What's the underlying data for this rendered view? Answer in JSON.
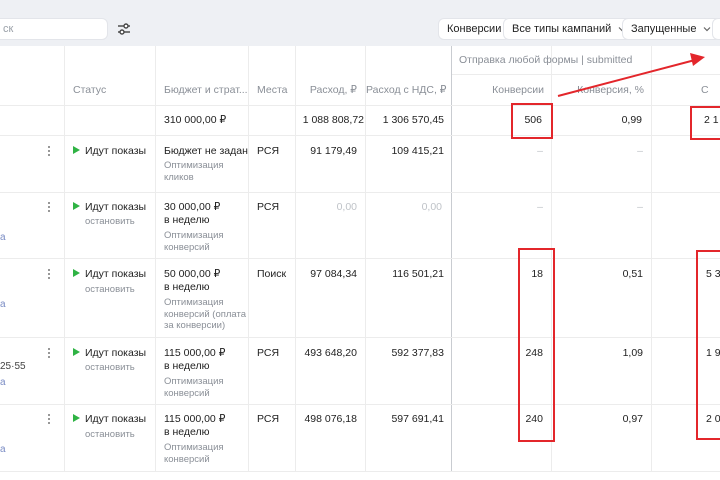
{
  "toolbar": {
    "search_placeholder": "ск",
    "filters": {
      "conversions": "Конверсии",
      "campaign_types": "Все типы кампаний",
      "launched": "Запущенные"
    }
  },
  "group_header": "Отправка любой формы | submitted",
  "columns": {
    "status": "Статус",
    "budget": "Бюджет и страт...",
    "places": "Места",
    "spend": "Расход, ₽",
    "spend_vat": "Расход с НДС, ₽",
    "conversions": "Конверсии",
    "conv_rate": "Конверсия, %",
    "last": "С"
  },
  "totals": {
    "budget": "310 000,00 ₽",
    "spend": "1 088 808,72",
    "spend_vat": "1 306 570,45",
    "conversions": "506",
    "conv_rate": "0,99",
    "last": "2 1"
  },
  "rows": [
    {
      "status": "Идут показы",
      "stop": "",
      "budget_line1": "Бюджет не задан",
      "budget_line2": "",
      "strategy": "Оптимизация\nкликов",
      "places": "РСЯ",
      "spend": "91 179,49",
      "spend_vat": "109 415,21",
      "conversions": "–",
      "conv_rate": "–",
      "last": "",
      "edge": ""
    },
    {
      "status": "Идут показы",
      "stop": "остановить",
      "budget_line1": "30 000,00 ₽",
      "budget_line2": "в неделю",
      "strategy": "Оптимизация\nконверсий",
      "places": "РСЯ",
      "spend": "0,00",
      "spend_vat": "0,00",
      "conversions": "–",
      "conv_rate": "–",
      "last": "",
      "edge": "а"
    },
    {
      "status": "Идут показы",
      "stop": "остановить",
      "budget_line1": "50 000,00 ₽",
      "budget_line2": "в неделю",
      "strategy": "Оптимизация\nконверсий (оплата\nза конверсии)",
      "places": "Поиск",
      "spend": "97 084,34",
      "spend_vat": "116 501,21",
      "conversions": "18",
      "conv_rate": "0,51",
      "last": "5 3",
      "edge": "а"
    },
    {
      "status": "Идут показы",
      "stop": "остановить",
      "budget_line1": "115 000,00 ₽",
      "budget_line2": "в неделю",
      "strategy": "Оптимизация\nконверсий",
      "places": "РСЯ",
      "spend": "493 648,20",
      "spend_vat": "592 377,83",
      "conversions": "248",
      "conv_rate": "1,09",
      "last": "1 9",
      "edge_top": "25·55",
      "edge": "а"
    },
    {
      "status": "Идут показы",
      "stop": "остановить",
      "budget_line1": "115 000,00 ₽",
      "budget_line2": "в неделю",
      "strategy": "Оптимизация\nконверсий",
      "places": "РСЯ",
      "spend": "498 076,18",
      "spend_vat": "597 691,41",
      "conversions": "240",
      "conv_rate": "0,97",
      "last": "2 0",
      "edge": "а"
    }
  ],
  "colors": {
    "annotation_red": "#e3262b",
    "status_green": "#2fb344",
    "toolbar_bg": "#eef0f4"
  }
}
